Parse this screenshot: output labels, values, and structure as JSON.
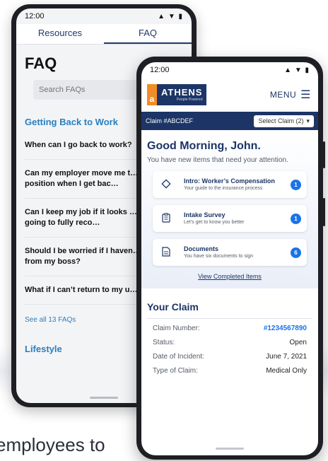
{
  "caption": "employees to",
  "phone_faq": {
    "status": {
      "time": "12:00",
      "icons": "▲ ▼ ▮"
    },
    "tabs": [
      "Resources",
      "FAQ"
    ],
    "title": "FAQ",
    "search_placeholder": "Search FAQs",
    "section1": "Getting Back to Work",
    "items": [
      "When can I go back to work?",
      "Can my employer move me t… new position when I get bac…",
      "Can I keep my job if it looks … I’m never going to fully reco…",
      "Should I be worried if I haven… heard from my boss?",
      "What if I can’t return to my u… job?"
    ],
    "see_all": "See all 13 FAQs",
    "section2": "Lifestyle"
  },
  "phone_dash": {
    "status": {
      "time": "12:00",
      "icons": "▲ ▼ ▮"
    },
    "logo": {
      "mark": "a",
      "word": "ATHENS",
      "tagline": "People Powered"
    },
    "menu_label": "MENU",
    "claim_id": "Claim #ABCDEF",
    "select_claim": "Select Claim (2)",
    "greeting": "Good Morning, John.",
    "greeting_sub": "You have new items that need your attention.",
    "cards": [
      {
        "icon": "diamond-icon",
        "title": "Intro: Worker’s Compensation",
        "subtitle": "Your guide to the insurance process",
        "count": "1"
      },
      {
        "icon": "clipboard-icon",
        "title": "Intake Survey",
        "subtitle": "Let’s get to know you better",
        "count": "1"
      },
      {
        "icon": "document-icon",
        "title": "Documents",
        "subtitle": "You have six documents to sign",
        "count": "6"
      }
    ],
    "view_completed": "View Completed Items",
    "your_claim_title": "Your Claim",
    "claim_rows": [
      {
        "label": "Claim Number:",
        "value": "#1234567890"
      },
      {
        "label": "Status:",
        "value": "Open"
      },
      {
        "label": "Date of Incident:",
        "value": "June 7, 2021"
      },
      {
        "label": "Type of Claim:",
        "value": "Medical Only"
      }
    ]
  }
}
